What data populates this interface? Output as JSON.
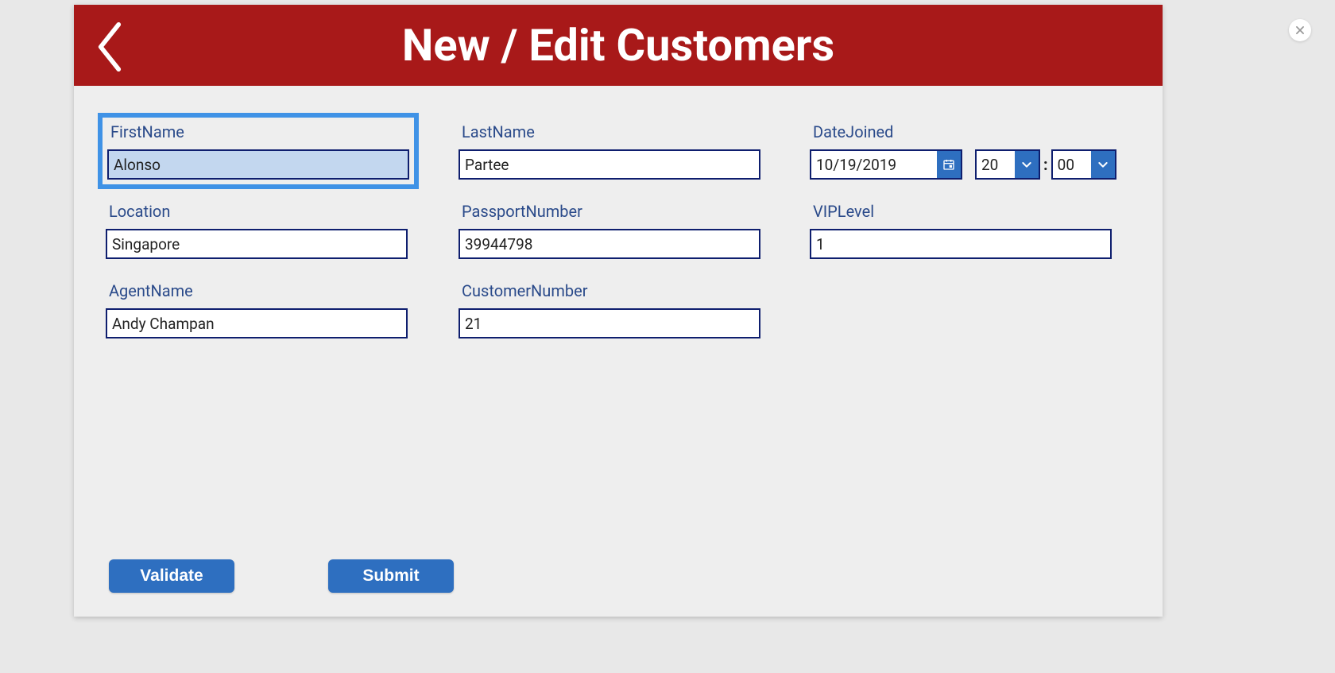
{
  "header": {
    "title": "New / Edit Customers"
  },
  "fields": {
    "firstName": {
      "label": "FirstName",
      "value": "Alonso"
    },
    "lastName": {
      "label": "LastName",
      "value": "Partee"
    },
    "dateJoined": {
      "label": "DateJoined",
      "date": "10/19/2019",
      "hour": "20",
      "minute": "00"
    },
    "location": {
      "label": "Location",
      "value": "Singapore"
    },
    "passportNumber": {
      "label": "PassportNumber",
      "value": "39944798"
    },
    "vipLevel": {
      "label": "VIPLevel",
      "value": "1"
    },
    "agentName": {
      "label": "AgentName",
      "value": "Andy Champan"
    },
    "customerNumber": {
      "label": "CustomerNumber",
      "value": "21"
    }
  },
  "buttons": {
    "validate": "Validate",
    "submit": "Submit"
  },
  "sep": {
    "colon": ":"
  }
}
